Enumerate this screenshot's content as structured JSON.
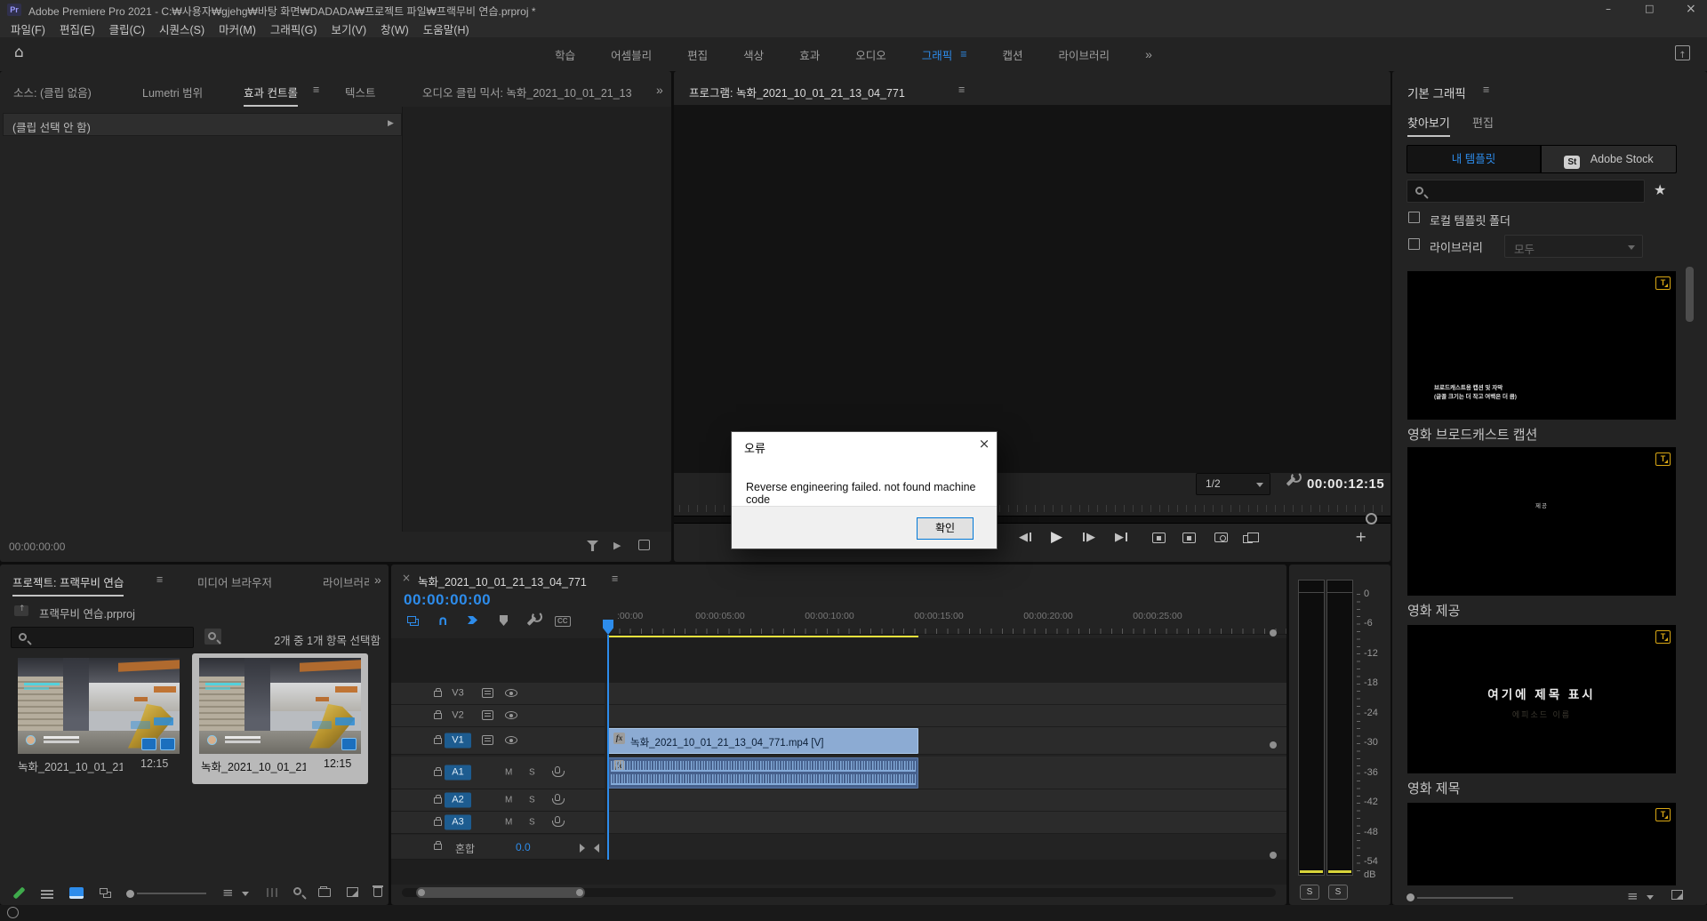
{
  "icons": {
    "menu": "≡",
    "overflow": "»",
    "home": "⌂",
    "up_arrow": "↑",
    "minimize": "–",
    "maximize": "□",
    "close": "×",
    "play": "▶",
    "tri_left": "◀",
    "tri_right": "▶",
    "plus": "+",
    "star": "★",
    "expand": "▶",
    "magnet": "∩"
  },
  "titlebar": {
    "app_badge": "Pr",
    "title": "Adobe Premiere Pro 2021 - C:₩사용자₩gjehg₩바탕 화면₩DADADA₩프로젝트 파일₩프랙무비 연습.prproj *"
  },
  "menubar": {
    "items": [
      "파일(F)",
      "편집(E)",
      "클립(C)",
      "시퀀스(S)",
      "마커(M)",
      "그래픽(G)",
      "보기(V)",
      "창(W)",
      "도움말(H)"
    ]
  },
  "workspace": {
    "tabs": [
      "학습",
      "어셈블리",
      "편집",
      "색상",
      "효과",
      "오디오",
      "그래픽",
      "캡션",
      "라이브러리"
    ],
    "active": "그래픽"
  },
  "source": {
    "tab_source": "소스: (클립 없음)",
    "tab_lumetri": "Lumetri 범위",
    "tab_effect_controls": "효과 컨트롤",
    "tab_text": "텍스트",
    "tab_audio_mixer": "오디오 클립 믹서: 녹화_2021_10_01_21_13",
    "clip_header": "(클립 선택 안 함)",
    "timecode": "00:00:00:00"
  },
  "program": {
    "title": "프로그램: 녹화_2021_10_01_21_13_04_771",
    "zoom_select": "1/2",
    "duration": "00:00:12:15"
  },
  "dialog": {
    "title": "오류",
    "message": "Reverse engineering failed. not found machine code",
    "ok": "확인"
  },
  "project": {
    "tab_project": "프로젝트: 프랙무비 연습",
    "tab_media_browser": "미디어 브라우저",
    "tab_libraries": "라이브러리",
    "breadcrumb": "프랙무비 연습.prproj",
    "status": "2개 중 1개 항목 선택함",
    "clips": [
      {
        "name": "녹화_2021_10_01_21...",
        "duration": "12:15"
      },
      {
        "name": "녹화_2021_10_01_21...",
        "duration": "12:15"
      }
    ]
  },
  "timeline": {
    "tab": "녹화_2021_10_01_21_13_04_771",
    "timecode": "00:00:00:00",
    "ruler": [
      ":00:00",
      "00:00:05:00",
      "00:00:10:00",
      "00:00:15:00",
      "00:00:20:00",
      "00:00:25:00"
    ],
    "tracks": {
      "v3": "V3",
      "v2": "V2",
      "v1": "V1",
      "a1": "A1",
      "a2": "A2",
      "a3": "A3",
      "mix": "혼합",
      "mix_value": "0.0",
      "mute": "M",
      "solo": "S"
    },
    "clip_label": "녹화_2021_10_01_21_13_04_771.mp4 [V]",
    "fx": "fx"
  },
  "meter": {
    "ticks": [
      "0",
      "-6",
      "-12",
      "-18",
      "-24",
      "-30",
      "-36",
      "-42",
      "-48",
      "-54"
    ],
    "unit": "dB",
    "solo": "S"
  },
  "graphics": {
    "title": "기본 그래픽",
    "tab_browse": "찾아보기",
    "tab_edit": "편집",
    "my_templates": "내 템플릿",
    "adobe_stock": "Adobe Stock",
    "stock_badge": "St",
    "chk_local": "로컬 템플릿 폴더",
    "chk_library": "라이브러리",
    "library_filter": "모두",
    "badge_t": "T",
    "cards": [
      {
        "label": "영화 브로드캐스트 캡션",
        "p1": "브로드캐스트용 캡션 및 자막",
        "p2": "(글꼴 크기는 더 작고 여백은 더 큼)"
      },
      {
        "label": "영화 제공",
        "p1": "제공",
        "p2": ""
      },
      {
        "label": "영화 제목",
        "p1": "여기에 제목 표시",
        "p2": "에피소드 이름"
      },
      {
        "label": "",
        "p1": "",
        "p2": ""
      }
    ]
  },
  "colors": {
    "accent": "#2d8ceb",
    "render_bar": "#e7e13c",
    "video_clip": "#8cabd3",
    "audio_clip": "#46608c",
    "selection": "#b9b9b9",
    "dialog_accent": "#0078d7",
    "mogrt_badge": "#d9a715"
  }
}
